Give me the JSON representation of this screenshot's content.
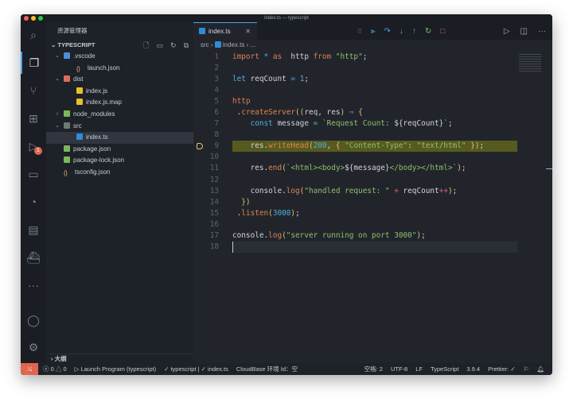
{
  "window": {
    "title": "index.ts — typescript"
  },
  "colors": {
    "accent": "#4aa3e8",
    "remote": "#e0664f",
    "debug_line": "#575a1f"
  },
  "activity_bar": {
    "items": [
      {
        "icon": "search-icon",
        "glyph": "⌕"
      },
      {
        "icon": "files-icon",
        "glyph": "❐"
      },
      {
        "icon": "source-control-icon",
        "glyph": "⑂"
      },
      {
        "icon": "extensions-icon",
        "glyph": "⊞"
      },
      {
        "icon": "debug-icon",
        "glyph": "▷",
        "badge": "1"
      },
      {
        "icon": "remote-explorer-icon",
        "glyph": "▭"
      },
      {
        "icon": "gitlens-icon",
        "glyph": "◔"
      },
      {
        "icon": "folder-icon",
        "glyph": "▤"
      },
      {
        "icon": "docker-icon",
        "glyph": "⛴"
      },
      {
        "icon": "more-icon",
        "glyph": "···"
      }
    ],
    "bottom": [
      {
        "icon": "account-icon",
        "glyph": "◯"
      },
      {
        "icon": "settings-gear-icon",
        "glyph": "⚙"
      }
    ]
  },
  "sidebar": {
    "title": "资源管理器",
    "section": "TYPESCRIPT",
    "outline": "大纲",
    "tree": [
      {
        "label": ".vscode",
        "depth": 1,
        "type": "folder",
        "open": true,
        "color": "#4a8fd8"
      },
      {
        "label": "launch.json",
        "depth": 2,
        "type": "json",
        "color": "#e5c07b"
      },
      {
        "label": "dist",
        "depth": 1,
        "type": "folder",
        "open": true,
        "color": "#e06c5c"
      },
      {
        "label": "index.js",
        "depth": 2,
        "type": "js",
        "color": "#e8c02a"
      },
      {
        "label": "index.js.map",
        "depth": 2,
        "type": "map",
        "color": "#e8c02a"
      },
      {
        "label": "node_modules",
        "depth": 1,
        "type": "folder",
        "open": false,
        "color": "#7cb85a"
      },
      {
        "label": "src",
        "depth": 1,
        "type": "folder",
        "open": true,
        "color": "#6f7a70"
      },
      {
        "label": "index.ts",
        "depth": 2,
        "type": "ts",
        "color": "#2f8dd6",
        "selected": true
      },
      {
        "label": "package.json",
        "depth": 1,
        "type": "npm",
        "color": "#7cb85a"
      },
      {
        "label": "package-lock.json",
        "depth": 1,
        "type": "npm",
        "color": "#7cb85a"
      },
      {
        "label": "tsconfig.json",
        "depth": 1,
        "type": "json",
        "color": "#e5c07b"
      }
    ]
  },
  "editor": {
    "tab": "index.ts",
    "breadcrumb": [
      "src",
      "index.ts",
      "..."
    ],
    "debug_toolbar": [
      {
        "icon": "continue-icon",
        "glyph": "⫸",
        "color": "#4aa3e8"
      },
      {
        "icon": "step-over-icon",
        "glyph": "↷",
        "color": "#4aa3e8"
      },
      {
        "icon": "step-into-icon",
        "glyph": "↓",
        "color": "#4aa3e8"
      },
      {
        "icon": "step-out-icon",
        "glyph": "↑",
        "color": "#4aa3e8"
      },
      {
        "icon": "restart-icon",
        "glyph": "↻",
        "color": "#7cc36a"
      },
      {
        "icon": "stop-icon",
        "glyph": "□",
        "color": "#e0664f"
      }
    ],
    "lines": [
      [
        [
          "k",
          "import"
        ],
        [
          "b",
          " * "
        ],
        [
          "k",
          "as"
        ],
        [
          "",
          "  http "
        ],
        [
          "k",
          "from"
        ],
        [
          "s",
          " \"http\""
        ],
        [
          "",
          ";"
        ]
      ],
      [],
      [
        [
          "b",
          "let"
        ],
        [
          "",
          " reqCount "
        ],
        [
          "b",
          "="
        ],
        [
          "n",
          " 1"
        ],
        [
          "",
          ";"
        ]
      ],
      [],
      [
        [
          "k",
          "http"
        ]
      ],
      [
        [
          "",
          " ."
        ],
        [
          "f",
          "createServer"
        ],
        [
          "p",
          "(("
        ],
        [
          "",
          "req, res"
        ],
        [
          "p",
          ")"
        ],
        [
          "b",
          " ⇒ "
        ],
        [
          "p",
          "{"
        ]
      ],
      [
        [
          "b",
          "    const"
        ],
        [
          "",
          " message "
        ],
        [
          "b",
          "="
        ],
        [
          "s",
          " `Request Count: "
        ],
        [
          "",
          "${reqCount}"
        ],
        [
          "s",
          "`"
        ],
        [
          "",
          ";"
        ]
      ],
      [],
      [
        [
          "",
          "    res."
        ],
        [
          "f",
          "writeHead"
        ],
        [
          "p",
          "("
        ],
        [
          "n",
          "200"
        ],
        [
          "",
          ", "
        ],
        [
          "p",
          "{"
        ],
        [
          "s",
          " \"Content-Type\""
        ],
        [
          "",
          ": "
        ],
        [
          "s",
          "\"text/html\" "
        ],
        [
          "p",
          "})"
        ],
        [
          "",
          ";"
        ]
      ],
      [],
      [
        [
          "",
          "    res."
        ],
        [
          "f",
          "end"
        ],
        [
          "p",
          "("
        ],
        [
          "s",
          "`<html><body>"
        ],
        [
          "",
          "${message}"
        ],
        [
          "s",
          "</body></html>`"
        ],
        [
          "p",
          ")"
        ],
        [
          "",
          ";"
        ]
      ],
      [],
      [
        [
          "",
          "    console."
        ],
        [
          "f",
          "log"
        ],
        [
          "p",
          "("
        ],
        [
          "s",
          "\"handled request: \""
        ],
        [
          "o",
          " +"
        ],
        [
          "",
          " reqCount"
        ],
        [
          "o",
          "++"
        ],
        [
          "p",
          ")"
        ],
        [
          "",
          ";"
        ]
      ],
      [
        [
          "p",
          "  })"
        ]
      ],
      [
        [
          "",
          " ."
        ],
        [
          "f",
          "listen"
        ],
        [
          "p",
          "("
        ],
        [
          "n",
          "3000"
        ],
        [
          "p",
          ")"
        ],
        [
          "",
          ";"
        ]
      ],
      [],
      [
        [
          "",
          "console."
        ],
        [
          "f",
          "log"
        ],
        [
          "p",
          "("
        ],
        [
          "s",
          "\"server running on port 3000\""
        ],
        [
          "p",
          ")"
        ],
        [
          "",
          ";"
        ]
      ],
      []
    ]
  },
  "status": {
    "errors": "0",
    "warnings": "0",
    "launch": "Launch Program (typescript)",
    "tsconfig": "✓ typescript | ✓ index.ts",
    "cloudbase": "CloudBase 环境 Id：空",
    "spaces": "空格: 2",
    "encoding": "UTF-8",
    "eol": "LF",
    "language": "TypeScript",
    "version": "3.9.4",
    "prettier": "Prettier: ✓"
  }
}
